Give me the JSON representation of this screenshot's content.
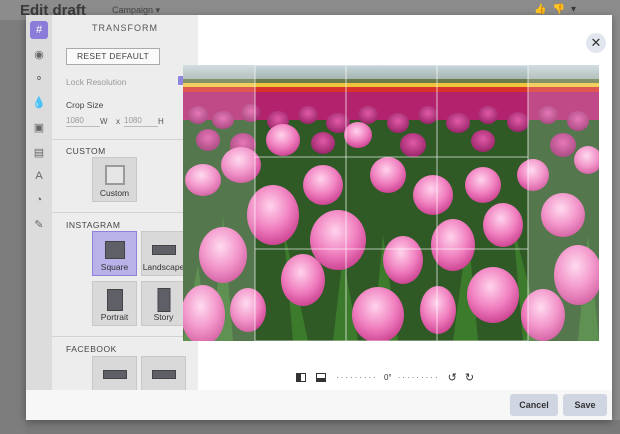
{
  "background": {
    "title": "Edit draft",
    "campaign": "Campaign ▾",
    "icons": [
      "thumbs-up-icon",
      "thumbs-down-icon",
      "more-icon"
    ]
  },
  "sidebar_icons": [
    "crop-icon",
    "filter-icon",
    "adjust-icon",
    "drop-icon",
    "frame-icon",
    "sticker-icon",
    "text-icon",
    "paint-icon",
    "brush-icon"
  ],
  "panel": {
    "title": "TRANSFORM",
    "reset_label": "RESET DEFAULT",
    "lock_label": "Lock Resolution",
    "lock_checked": true,
    "crop_label": "Crop Size",
    "width_value": "1080",
    "width_unit": "W",
    "times": "x",
    "height_value": "1080",
    "height_unit": "H",
    "custom_heading": "CUSTOM",
    "custom_label": "Custom",
    "instagram_heading": "INSTAGRAM",
    "instagram_items": [
      "Square",
      "Landscape",
      "Portrait",
      "Story"
    ],
    "instagram_selected": "Square",
    "facebook_heading": "FACEBOOK"
  },
  "canvas": {
    "angle": "0°"
  },
  "footer": {
    "cancel_label": "Cancel",
    "save_label": "Save"
  },
  "colors": {
    "accent": "#8a7cd8",
    "selected_tile": "#b8b2e8",
    "button": "#cfd6e2"
  }
}
